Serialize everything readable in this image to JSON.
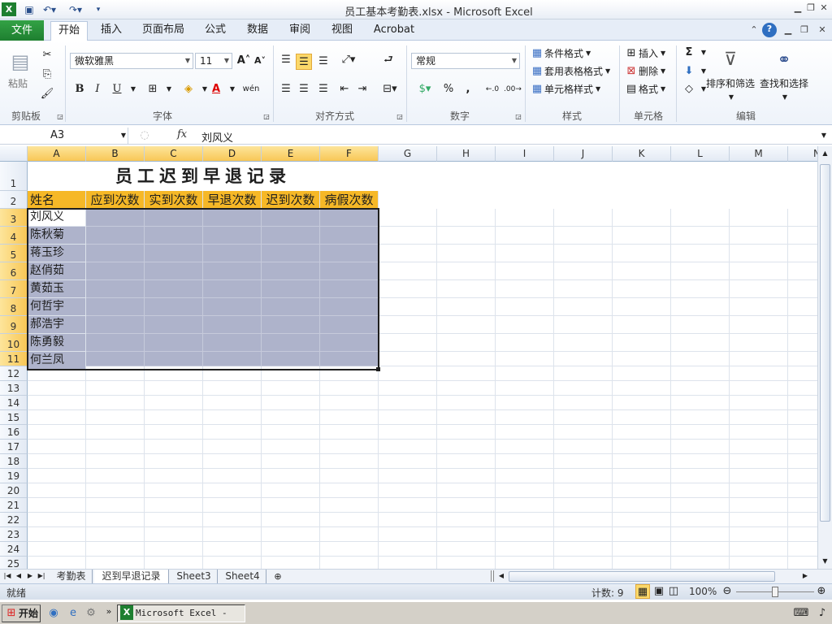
{
  "window": {
    "title": "员工基本考勤表.xlsx - Microsoft Excel"
  },
  "ribbon_tabs": [
    "文件",
    "开始",
    "插入",
    "页面布局",
    "公式",
    "数据",
    "审阅",
    "视图",
    "Acrobat"
  ],
  "ribbon": {
    "clipboard": {
      "label": "剪贴板",
      "paste": "粘贴"
    },
    "font": {
      "label": "字体",
      "name": "微软雅黑",
      "size": "11",
      "bold": "B",
      "italic": "I",
      "underline": "U",
      "wen": "wén"
    },
    "alignment": {
      "label": "对齐方式"
    },
    "number": {
      "label": "数字",
      "format": "常规",
      "percent": "%",
      "comma": ","
    },
    "styles": {
      "label": "样式",
      "conditional": "条件格式",
      "table_format": "套用表格格式",
      "cell_styles": "单元格样式"
    },
    "cells": {
      "label": "单元格",
      "insert": "插入",
      "delete": "删除",
      "format": "格式"
    },
    "editing": {
      "label": "编辑",
      "sum": "Σ",
      "sort_filter": "排序和筛选",
      "find_select": "查找和选择"
    }
  },
  "formula_bar": {
    "name_box": "A3",
    "fx": "fx",
    "value": "刘风义"
  },
  "columns": [
    "A",
    "B",
    "C",
    "D",
    "E",
    "F",
    "G",
    "H",
    "I",
    "J",
    "K",
    "L",
    "M",
    "N"
  ],
  "rows": [
    "1",
    "2",
    "3",
    "4",
    "5",
    "6",
    "7",
    "8",
    "9",
    "10",
    "11",
    "12",
    "13",
    "14",
    "15",
    "16",
    "17",
    "18",
    "19",
    "20",
    "21",
    "22",
    "23",
    "24",
    "25"
  ],
  "sheet": {
    "title": "员工迟到早退记录",
    "headers": [
      "姓名",
      "应到次数",
      "实到次数",
      "早退次数",
      "迟到次数",
      "病假次数"
    ],
    "names": [
      "刘风义",
      "陈秋菊",
      "蒋玉珍",
      "赵俏茹",
      "黄茹玉",
      "何哲宇",
      "郝浩宇",
      "陈勇毅",
      "何兰凤"
    ]
  },
  "sheet_tabs": [
    "考勤表",
    "迟到早退记录",
    "Sheet3",
    "Sheet4"
  ],
  "status": {
    "ready": "就绪",
    "count": "计数: 9",
    "zoom": "100%"
  },
  "taskbar": {
    "start": "开始",
    "excel_task": "Microsoft Excel - ..."
  },
  "colors": {
    "header_fill": "#f6b827",
    "range_fill": "#aeb3cb",
    "file_tab": "#2a9a3d"
  }
}
